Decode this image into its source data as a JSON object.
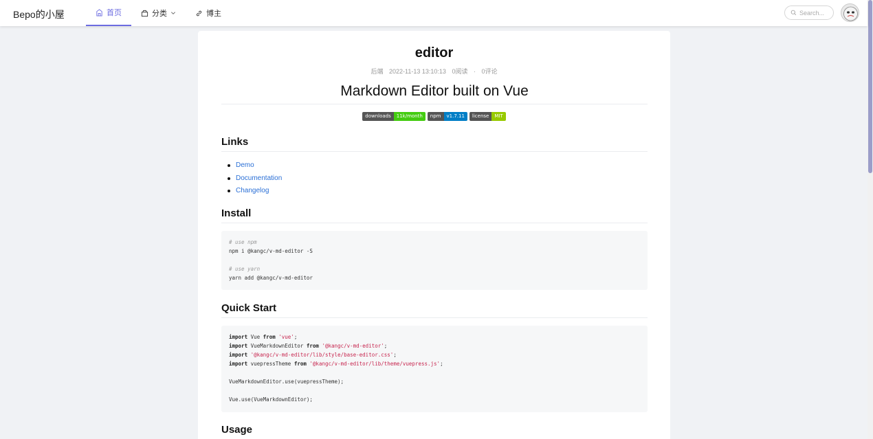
{
  "header": {
    "brand": "Bepo的小屋",
    "nav": [
      {
        "label": "首页",
        "icon": "home-icon",
        "active": true
      },
      {
        "label": "分类",
        "icon": "category-icon",
        "dropdown": true
      },
      {
        "label": "博主",
        "icon": "link-icon"
      }
    ],
    "search": {
      "placeholder": "Search..."
    }
  },
  "article": {
    "title": "editor",
    "meta": {
      "category": "后端",
      "datetime": "2022-11-13 13:10:13",
      "reads": "0阅读",
      "separator": "·",
      "comments": "0评论"
    },
    "h1": "Markdown Editor built on Vue",
    "badges": [
      {
        "key": "downloads",
        "value": "11k/month",
        "color": "#4c1"
      },
      {
        "key": "npm",
        "value": "v1.7.11",
        "color": "#007ec6"
      },
      {
        "key": "license",
        "value": "MIT",
        "color": "#97ca00"
      }
    ],
    "sections": {
      "links": "Links",
      "install": "Install",
      "quickstart": "Quick Start",
      "usage": "Usage"
    },
    "links": [
      "Demo",
      "Documentation",
      "Changelog"
    ],
    "install_code": {
      "c1": "# use npm",
      "l1": "npm i @kangc/v-md-editor -S",
      "c2": "# use yarn",
      "l2": "yarn add @kangc/v-md-editor"
    },
    "quickstart_code": {
      "kw_import": "import",
      "kw_from": "from",
      "l1_name": " Vue ",
      "l1_str": "'vue'",
      "l2_name": " VueMarkdownEditor ",
      "l2_str": "'@kangc/v-md-editor'",
      "l3_str": "'@kangc/v-md-editor/lib/style/base-editor.css'",
      "l4_name": " vuepressTheme ",
      "l4_str": "'@kangc/v-md-editor/lib/theme/vuepress.js'",
      "semi": ";",
      "use1": "VueMarkdownEditor.use(vuepressTheme);",
      "use2": "Vue.use(VueMarkdownEditor);"
    }
  }
}
